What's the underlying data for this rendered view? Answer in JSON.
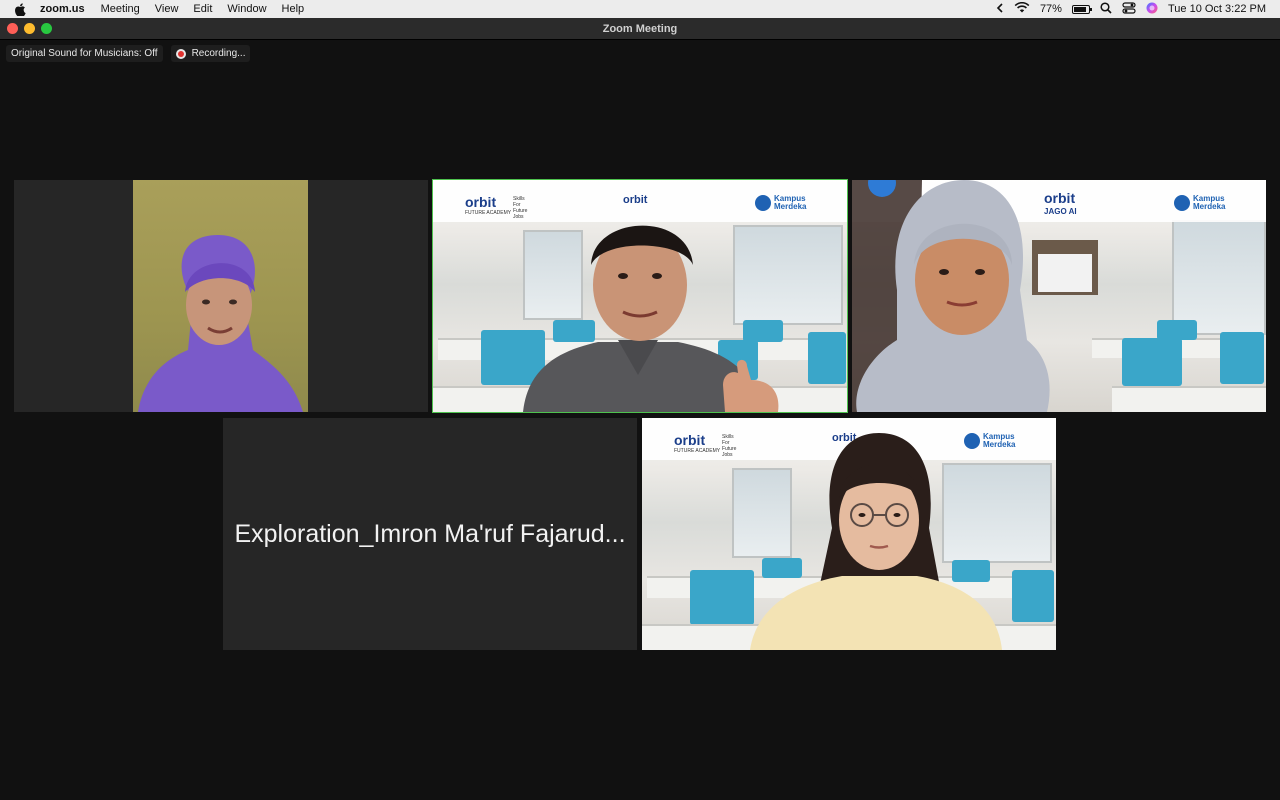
{
  "menubar": {
    "app_name": "zoom.us",
    "menus": [
      "Meeting",
      "View",
      "Edit",
      "Window",
      "Help"
    ],
    "battery": "77%",
    "datetime": "Tue 10 Oct  3:22 PM"
  },
  "window": {
    "title": "Zoom Meeting"
  },
  "status": {
    "original_sound": "Original Sound for Musicians: Off",
    "recording": "Recording..."
  },
  "tiles": {
    "name_tile_label": "Exploration_Imron Ma'ruf Fajarud...",
    "orbit_text": "orbit",
    "orbit_sub": "FUTURE ACADEMY",
    "orbit_tagline": "Skills For Future Jobs",
    "jago_ai": "JAGO AI",
    "kampus_line1": "Kampus",
    "kampus_line2": "Merdeka"
  },
  "colors": {
    "active_speaker": "#4ec34e",
    "recording_red": "#e0322f"
  }
}
